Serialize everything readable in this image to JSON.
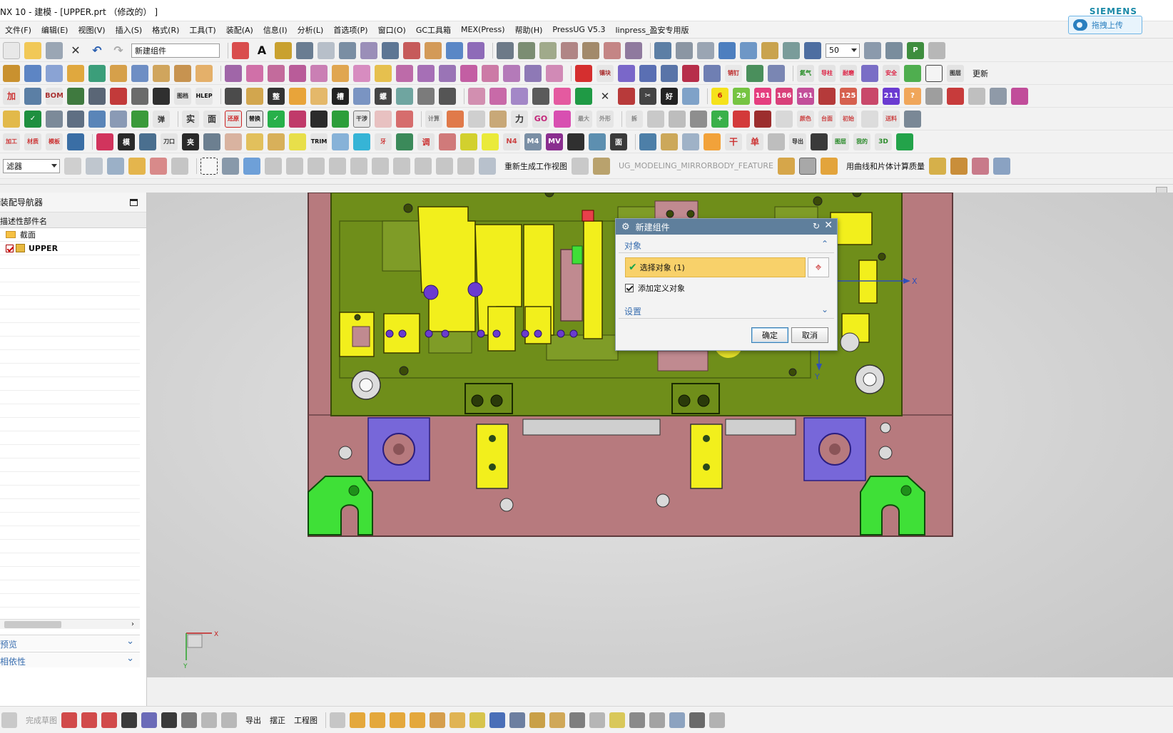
{
  "window": {
    "title": "NX 10 - 建模 - [UPPER.prt （修改的） ]",
    "brand": "SIEMENS",
    "upload_button": "拖拽上传"
  },
  "menu": [
    "文件(F)",
    "编辑(E)",
    "视图(V)",
    "插入(S)",
    "格式(R)",
    "工具(T)",
    "装配(A)",
    "信息(I)",
    "分析(L)",
    "首选项(P)",
    "窗口(O)",
    "GC工具箱",
    "MEX(Press)",
    "帮助(H)",
    "PressUG V5.3",
    "linpress_盈安专用版"
  ],
  "toolbar": {
    "command_finder": "新建组件",
    "zoom_value": "50",
    "filter_value": "滤器",
    "regenerate_view": "重新生成工作视图",
    "feature_name": "UG_MODELING_MIRRORBODY_FEATURE",
    "mass_calc": "用曲线和片体计算质量"
  },
  "navigator": {
    "title": "装配导航器",
    "column_header": "描述性部件名",
    "items": [
      {
        "label": "截面"
      },
      {
        "label": "UPPER"
      }
    ],
    "sections": [
      "预览",
      "相依性"
    ]
  },
  "dialog": {
    "title": "新建组件",
    "group_object": "对象",
    "select_object": "选择对象 (1)",
    "add_defined_objects": "添加定义对象",
    "group_settings": "设置",
    "ok": "确定",
    "cancel": "取消"
  },
  "viewport": {
    "axis_x": "X",
    "axis_y": "Y",
    "triad_x": "X",
    "triad_y": "Y"
  },
  "statusbar": {
    "hint": "完成草图",
    "export": "导出",
    "straighten": "摆正",
    "drawing": "工程图"
  },
  "colors": {
    "die_plate": "#b77a7e",
    "upper_plate": "#6f8e1a",
    "yellow_insert": "#f2ef1c",
    "purple_block": "#7767d9",
    "green_clamp": "#3fe037",
    "dialog_title": "#5f7f9c",
    "selection_row": "#f8d16a"
  }
}
